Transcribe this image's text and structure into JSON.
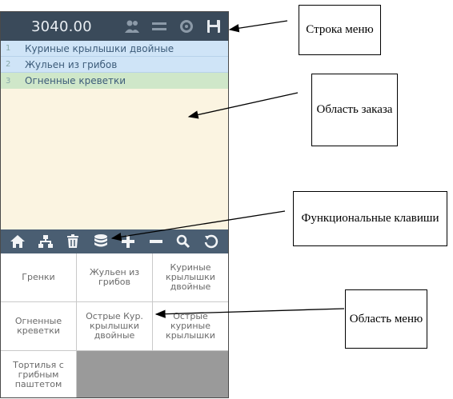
{
  "header": {
    "total": "3040.00",
    "icons": [
      "users-icon",
      "menu-icon",
      "settings-icon",
      "save-icon"
    ]
  },
  "order": {
    "items": [
      {
        "num": "1",
        "name": "Куриные крылышки двойные"
      },
      {
        "num": "2",
        "name": "Жульен из грибов"
      },
      {
        "num": "3",
        "name": "Огненные креветки"
      }
    ]
  },
  "function_keys": [
    "home-icon",
    "hierarchy-icon",
    "delete-icon",
    "database-icon",
    "plus-icon",
    "minus-icon",
    "search-icon",
    "undo-icon"
  ],
  "menu": {
    "items": [
      "Гренки",
      "Жульен из грибов",
      "Куриные крылышки двойные",
      "Огненные креветки",
      "Острые Кур. крылышки двойные",
      "Острые куриные крылышки",
      "Тортилья с грибным паштетом"
    ]
  },
  "callouts": {
    "menu_bar": "Строка меню",
    "order_area": "Область заказа",
    "function_keys": "Функциональные клавиши",
    "menu_area": "Область меню"
  }
}
